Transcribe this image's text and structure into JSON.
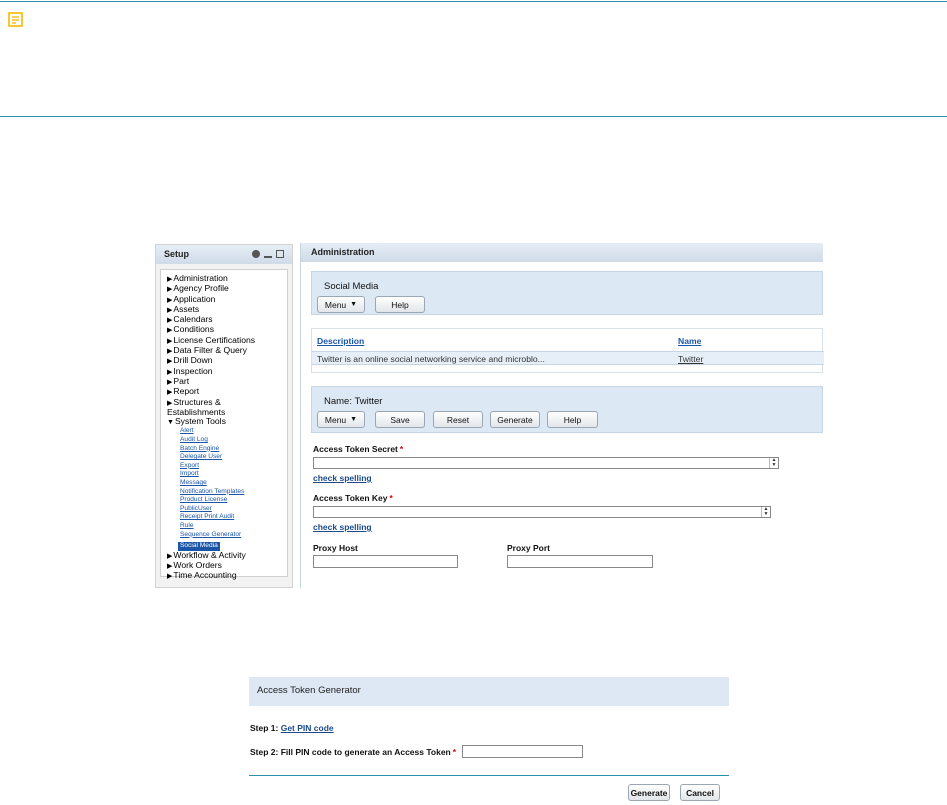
{
  "setup": {
    "title": "Setup",
    "tree": [
      "Administration",
      "Agency Profile",
      "Application",
      "Assets",
      "Calendars",
      "Conditions",
      "License Certifications",
      "Data Filter & Query",
      "Drill Down",
      "Inspection",
      "Part",
      "Report",
      "Structures & Establishments",
      "System Tools"
    ],
    "system_tools_children": [
      "Alert",
      "Audit Log",
      "Batch Engine",
      "Delegate User",
      "Export",
      "Import",
      "Message",
      "Notification Templates",
      "Product License",
      "PublicUser",
      "Receipt Print Audit",
      "Rule",
      "Sequence Generator",
      "Social Media"
    ],
    "tree_after": [
      "Workflow & Activity",
      "Work Orders",
      "Time Accounting"
    ]
  },
  "admin": {
    "title": "Administration",
    "social_media": {
      "title": "Social Media",
      "menu_label": "Menu",
      "help_label": "Help"
    },
    "grid": {
      "col_description": "Description",
      "col_name": "Name",
      "row_description": "Twitter is an online social networking service and microblo...",
      "row_name": "Twitter"
    },
    "detail": {
      "title": "Name: Twitter",
      "menu_label": "Menu",
      "save_label": "Save",
      "reset_label": "Reset",
      "generate_label": "Generate",
      "help_label": "Help"
    },
    "fields": {
      "access_token_secret_label": "Access Token Secret",
      "access_token_key_label": "Access Token Key",
      "check_spelling": "check spelling",
      "proxy_host_label": "Proxy Host",
      "proxy_port_label": "Proxy Port",
      "required_mark": "*"
    }
  },
  "generator": {
    "title": "Access Token Generator",
    "step1_prefix": "Step 1:",
    "step1_link": "Get PIN code",
    "step2_label": "Step 2: Fill PIN code to generate an Access Token",
    "required_mark": "*",
    "generate_label": "Generate",
    "cancel_label": "Cancel"
  },
  "icons": {
    "note": "note-icon",
    "tree_arrow": "triangle-right-icon"
  },
  "colors": {
    "accent_line": "#2c8fa8",
    "link": "#1a55a8",
    "section_bg": "#dce8f4",
    "required": "#d40000",
    "note_icon": "#f5b800"
  }
}
